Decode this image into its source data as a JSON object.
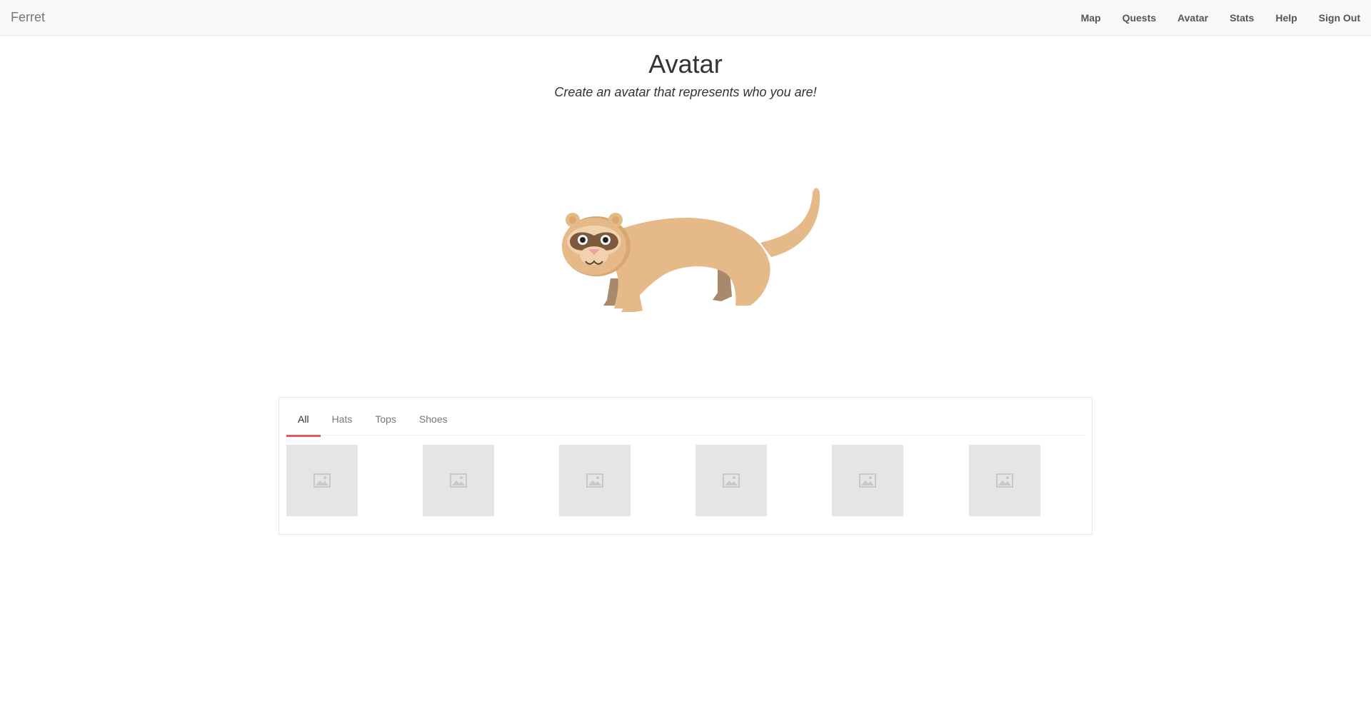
{
  "navbar": {
    "brand": "Ferret",
    "links": [
      {
        "label": "Map"
      },
      {
        "label": "Quests"
      },
      {
        "label": "Avatar"
      },
      {
        "label": "Stats"
      },
      {
        "label": "Help"
      },
      {
        "label": "Sign Out"
      }
    ]
  },
  "page": {
    "title": "Avatar",
    "subtitle": "Create an avatar that represents who you are!"
  },
  "avatar": {
    "image": "ferret-illustration",
    "colors": {
      "body": "#e5b988",
      "dark": "#a8896b",
      "mask": "#7d5a3c",
      "nose": "#f0a0a8"
    }
  },
  "wardrobe": {
    "tabs": [
      {
        "label": "All",
        "active": true
      },
      {
        "label": "Hats",
        "active": false
      },
      {
        "label": "Tops",
        "active": false
      },
      {
        "label": "Shoes",
        "active": false
      }
    ],
    "items": [
      {
        "icon": "image-placeholder-icon"
      },
      {
        "icon": "image-placeholder-icon"
      },
      {
        "icon": "image-placeholder-icon"
      },
      {
        "icon": "image-placeholder-icon"
      },
      {
        "icon": "image-placeholder-icon"
      },
      {
        "icon": "image-placeholder-icon"
      }
    ],
    "accent_color": "#e05a5f"
  }
}
